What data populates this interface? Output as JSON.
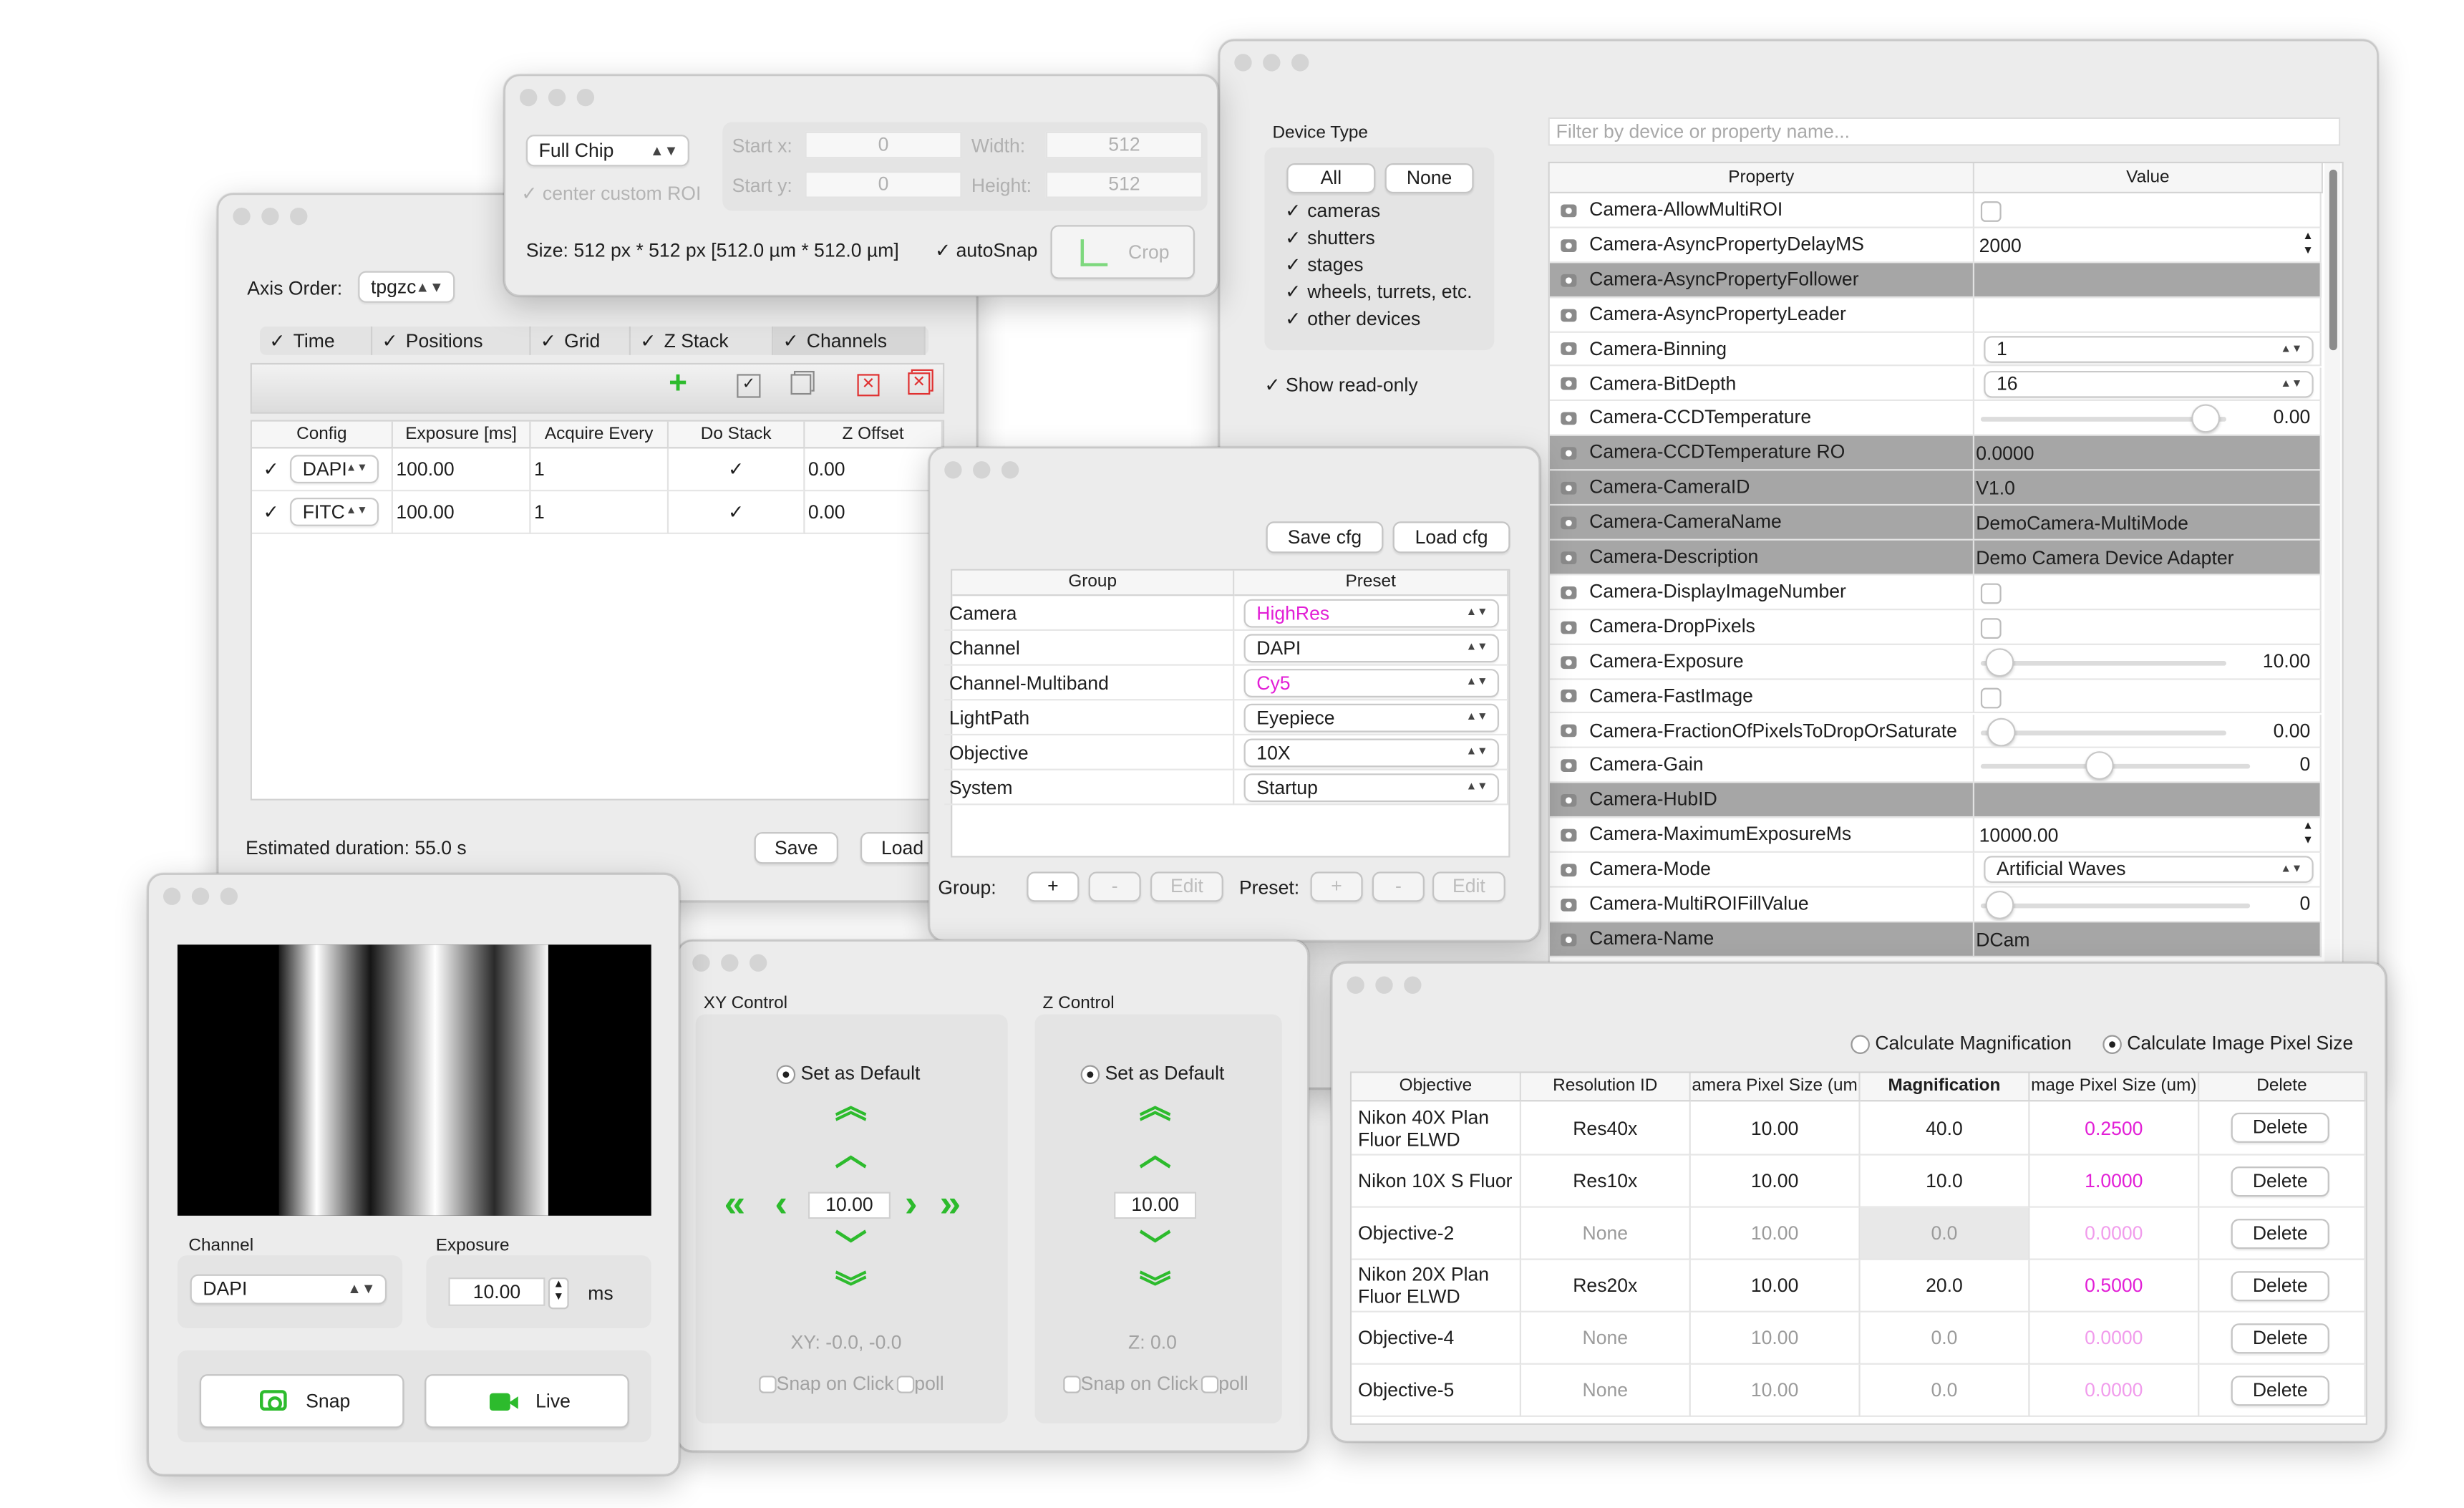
{
  "roi": {
    "mode": "Full Chip",
    "center_label": "center custom ROI",
    "start_x_label": "Start x:",
    "start_x": "0",
    "start_y_label": "Start y:",
    "start_y": "0",
    "width_label": "Width:",
    "width": "512",
    "height_label": "Height:",
    "height": "512",
    "size_text": "Size: 512 px * 512 px [512.0 µm * 512.0 µm]",
    "autosnap_label": "autoSnap",
    "crop_label": "Crop"
  },
  "mda": {
    "axis_order_label": "Axis Order:",
    "axis_order": "tpgzc",
    "tabs": [
      "Time",
      "Positions",
      "Grid",
      "Z Stack",
      "Channels"
    ],
    "columns": [
      "Config",
      "Exposure [ms]",
      "Acquire Every",
      "Do Stack",
      "Z Offset"
    ],
    "rows": [
      {
        "config": "DAPI",
        "exposure": "100.00",
        "every": "1",
        "offset": "0.00"
      },
      {
        "config": "FITC",
        "exposure": "100.00",
        "every": "1",
        "offset": "0.00"
      }
    ],
    "duration": "Estimated duration: 55.0 s",
    "save_label": "Save",
    "load_label": "Load"
  },
  "props": {
    "device_type_label": "Device Type",
    "all_label": "All",
    "none_label": "None",
    "devices": [
      "cameras",
      "shutters",
      "stages",
      "wheels, turrets, etc.",
      "other devices"
    ],
    "show_readonly": "Show read-only",
    "filter_placeholder": "Filter by device or property name...",
    "col_property": "Property",
    "col_value": "Value",
    "rows": [
      {
        "name": "Camera-AllowMultiROI",
        "value": ""
      },
      {
        "name": "Camera-AsyncPropertyDelayMS",
        "value": "2000"
      },
      {
        "name": "Camera-AsyncPropertyFollower",
        "value": ""
      },
      {
        "name": "Camera-AsyncPropertyLeader",
        "value": ""
      },
      {
        "name": "Camera-Binning",
        "value": "1"
      },
      {
        "name": "Camera-BitDepth",
        "value": "16"
      },
      {
        "name": "Camera-CCDTemperature",
        "value": "0.00"
      },
      {
        "name": "Camera-CCDTemperature RO",
        "value": "0.0000"
      },
      {
        "name": "Camera-CameraID",
        "value": "V1.0"
      },
      {
        "name": "Camera-CameraName",
        "value": "DemoCamera-MultiMode"
      },
      {
        "name": "Camera-Description",
        "value": "Demo Camera Device Adapter"
      },
      {
        "name": "Camera-DisplayImageNumber",
        "value": ""
      },
      {
        "name": "Camera-DropPixels",
        "value": ""
      },
      {
        "name": "Camera-Exposure",
        "value": "10.00"
      },
      {
        "name": "Camera-FastImage",
        "value": ""
      },
      {
        "name": "Camera-FractionOfPixelsToDropOrSaturate",
        "value": "0.00"
      },
      {
        "name": "Camera-Gain",
        "value": "0"
      },
      {
        "name": "Camera-HubID",
        "value": ""
      },
      {
        "name": "Camera-MaximumExposureMs",
        "value": "10000.00"
      },
      {
        "name": "Camera-Mode",
        "value": "Artificial Waves"
      },
      {
        "name": "Camera-MultiROIFillValue",
        "value": "0"
      },
      {
        "name": "Camera-Name",
        "value": "DCam"
      }
    ]
  },
  "groups": {
    "save_cfg": "Save cfg",
    "load_cfg": "Load cfg",
    "col_group": "Group",
    "col_preset": "Preset",
    "rows": [
      {
        "group": "Camera",
        "preset": "HighRes"
      },
      {
        "group": "Channel",
        "preset": "DAPI"
      },
      {
        "group": "Channel-Multiband",
        "preset": "Cy5"
      },
      {
        "group": "LightPath",
        "preset": "Eyepiece"
      },
      {
        "group": "Objective",
        "preset": "10X"
      },
      {
        "group": "System",
        "preset": "Startup"
      }
    ],
    "group_label": "Group:",
    "preset_label": "Preset:",
    "plus": "+",
    "minus": "-",
    "edit": "Edit"
  },
  "snap": {
    "channel_label": "Channel",
    "channel": "DAPI",
    "exposure_label": "Exposure",
    "exposure": "10.00",
    "ms": "ms",
    "snap_label": "Snap",
    "live_label": "Live"
  },
  "stage": {
    "xy_title": "XY Control",
    "z_title": "Z Control",
    "set_default": "Set as Default",
    "xy_step": "10.00",
    "z_step": "10.00",
    "xy_pos": "XY:  -0.0, -0.0",
    "z_pos": "Z:  0.0",
    "snap_on_click": "Snap on Click",
    "poll": "poll"
  },
  "pixel": {
    "calc_mag": "Calculate Magnification",
    "calc_pix": "Calculate Image Pixel Size",
    "columns": [
      "Objective",
      "Resolution ID",
      "amera Pixel Size (um",
      "Magnification",
      "mage Pixel Size (um)",
      "Delete"
    ],
    "rows": [
      {
        "objective": "Nikon 40X Plan Fluor ELWD",
        "res": "Res40x",
        "cam": "10.00",
        "mag": "40.0",
        "img": "0.2500"
      },
      {
        "objective": "Nikon 10X S Fluor",
        "res": "Res10x",
        "cam": "10.00",
        "mag": "10.0",
        "img": "1.0000"
      },
      {
        "objective": "Objective-2",
        "res": "None",
        "cam": "10.00",
        "mag": "0.0",
        "img": "0.0000"
      },
      {
        "objective": "Nikon 20X Plan Fluor ELWD",
        "res": "Res20x",
        "cam": "10.00",
        "mag": "20.0",
        "img": "0.5000"
      },
      {
        "objective": "Objective-4",
        "res": "None",
        "cam": "10.00",
        "mag": "0.0",
        "img": "0.0000"
      },
      {
        "objective": "Objective-5",
        "res": "None",
        "cam": "10.00",
        "mag": "0.0",
        "img": "0.0000"
      }
    ],
    "delete_label": "Delete"
  },
  "colors": {
    "accent_green": "#2dbb2d",
    "magenta": "#e21fd6",
    "selected_row": "#a6a6a6"
  }
}
